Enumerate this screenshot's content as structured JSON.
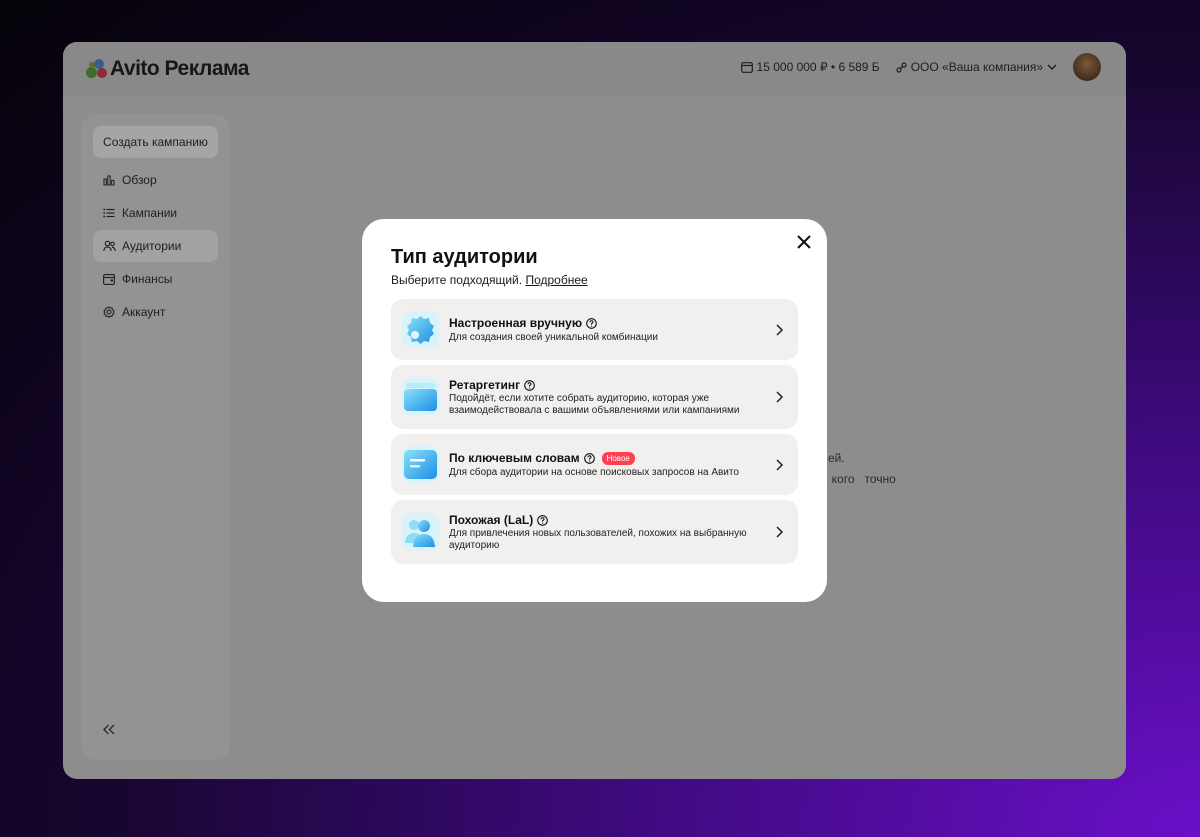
{
  "app": {
    "logo_text": "Avito Реклама"
  },
  "header": {
    "balance": "15 000 000 ₽ • 6 589 Б",
    "company": "ООО «Ваша компания»"
  },
  "sidebar": {
    "create_button": "Создать кампанию",
    "items": [
      {
        "label": "Обзор",
        "icon": "bar-chart-icon"
      },
      {
        "label": "Кампании",
        "icon": "list-icon"
      },
      {
        "label": "Аудитории",
        "icon": "users-icon",
        "active": true
      },
      {
        "label": "Финансы",
        "icon": "wallet-icon"
      },
      {
        "label": "Аккаунт",
        "icon": "gear-icon"
      }
    ],
    "collapse_icon": "double-chevron-left-icon"
  },
  "background": {
    "text_line_1": "ей.",
    "text_line_2": ", кого   точно"
  },
  "modal": {
    "title": "Тип аудитории",
    "subtitle": "Выберите подходящий.",
    "subtitle_link": "Подробнее",
    "options": [
      {
        "title": "Настроенная вручную",
        "description": "Для создания своей уникальной комбинации",
        "icon": "gear-icon"
      },
      {
        "title": "Ретаргетинг",
        "description": "Подойдёт, если хотите собрать аудиторию, которая уже взаимодействовала с вашими объявлениями или кампаниями",
        "icon": "layers-icon"
      },
      {
        "title": "По ключевым словам",
        "badge": "Новое",
        "description": "Для сбора аудитории на основе поисковых запросов на Авито",
        "icon": "document-icon"
      },
      {
        "title": "Похожая (LaL)",
        "description": "Для привлечения новых пользователей, похожих на выбранную аудиторию",
        "icon": "users-icon"
      }
    ]
  },
  "colors": {
    "badge": "#ff4053",
    "option_bg": "#f2f0ef",
    "icon_gradient_start": "#8be0f8",
    "icon_gradient_end": "#1d8fe5"
  }
}
